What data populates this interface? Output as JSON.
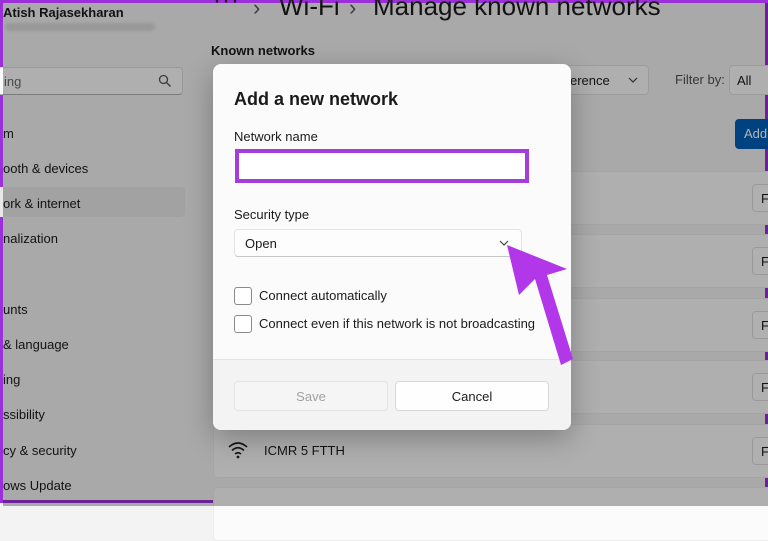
{
  "window": {
    "user_name": "Atish Rajasekharan",
    "search_placeholder": "ing",
    "breadcrumb": {
      "dots": "···",
      "parent": "Wi-Fi",
      "title": "Manage known networks"
    },
    "nav_items": [
      {
        "label": "m"
      },
      {
        "label": "ooth & devices"
      },
      {
        "label": "ork & internet"
      },
      {
        "label": "nalization"
      },
      {
        "label": "unts"
      },
      {
        "label": "& language"
      },
      {
        "label": "ing"
      },
      {
        "label": "ssibility"
      },
      {
        "label": "cy & security"
      },
      {
        "label": "ows Update"
      }
    ],
    "known_networks_label": "Known networks",
    "sort_value": "erence",
    "filter_label": "Filter by:",
    "filter_value": "All",
    "add_label": "Add",
    "forget_label": "Fo",
    "network_rows": [
      {
        "name": ""
      },
      {
        "name": ""
      },
      {
        "name": ""
      },
      {
        "name": ""
      },
      {
        "name": "ICMR 5 FTTH"
      }
    ]
  },
  "dialog": {
    "title": "Add a new network",
    "network_name_label": "Network name",
    "network_name_value": "",
    "security_type_label": "Security type",
    "security_type_value": "Open",
    "checkbox_auto": "Connect automatically",
    "checkbox_hidden": "Connect even if this network is not broadcasting",
    "save_label": "Save",
    "cancel_label": "Cancel"
  },
  "colors": {
    "highlight": "#a63ddb",
    "arrow": "#b237e8",
    "accent": "#005fb8"
  },
  "icons": [
    "search-icon",
    "chevron-down-icon",
    "wifi-icon",
    "arrow-annotation"
  ]
}
